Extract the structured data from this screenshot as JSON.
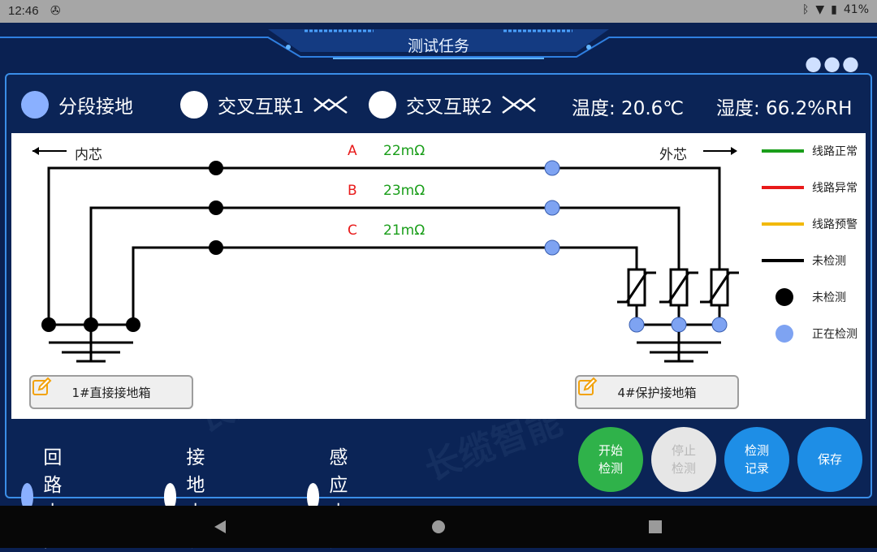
{
  "statusbar": {
    "time": "12:46",
    "battery": "41%"
  },
  "header": {
    "title": "测试任务"
  },
  "modes": [
    {
      "label": "分段接地",
      "selected": true
    },
    {
      "label": "交叉互联1",
      "selected": false
    },
    {
      "label": "交叉互联2",
      "selected": false
    }
  ],
  "environment": {
    "temperature": "温度: 20.6℃",
    "humidity": "湿度: 66.2%RH"
  },
  "diagram": {
    "inner_label": "内芯",
    "outer_label": "外芯",
    "phases": [
      {
        "name": "A",
        "value": "22mΩ"
      },
      {
        "name": "B",
        "value": "23mΩ"
      },
      {
        "name": "C",
        "value": "21mΩ"
      }
    ],
    "left_box": "1#直接接地箱",
    "right_box": "4#保护接地箱"
  },
  "legend": [
    {
      "label": "线路正常",
      "color": "#1a9e1a",
      "kind": "line"
    },
    {
      "label": "线路异常",
      "color": "#e81a1a",
      "kind": "line"
    },
    {
      "label": "线路预警",
      "color": "#f2b90c",
      "kind": "line"
    },
    {
      "label": "未检测",
      "color": "#000000",
      "kind": "line"
    },
    {
      "label": "未检测",
      "color": "#000000",
      "kind": "dot"
    },
    {
      "label": "正在检测",
      "color": "#7ea3f2",
      "kind": "dot"
    }
  ],
  "measurements": [
    {
      "label": "回路电阻",
      "selected": true
    },
    {
      "label": "接地电流",
      "selected": false
    },
    {
      "label": "感应电压",
      "selected": false
    }
  ],
  "buttons": {
    "start": "开始\n检测",
    "stop": "停止\n检测",
    "records": "检测\n记录",
    "save": "保存"
  },
  "watermark": {
    "brand_cn": "长缆智能",
    "brand_en": "CHANGLAN"
  },
  "colors": {
    "accent": "#3a8ee8",
    "start": "#2fb24a",
    "stop": "#e6e6e6",
    "blue_btn": "#1e8ee6",
    "value_green": "#1a9e1a",
    "phase_red": "#e81a1a"
  }
}
